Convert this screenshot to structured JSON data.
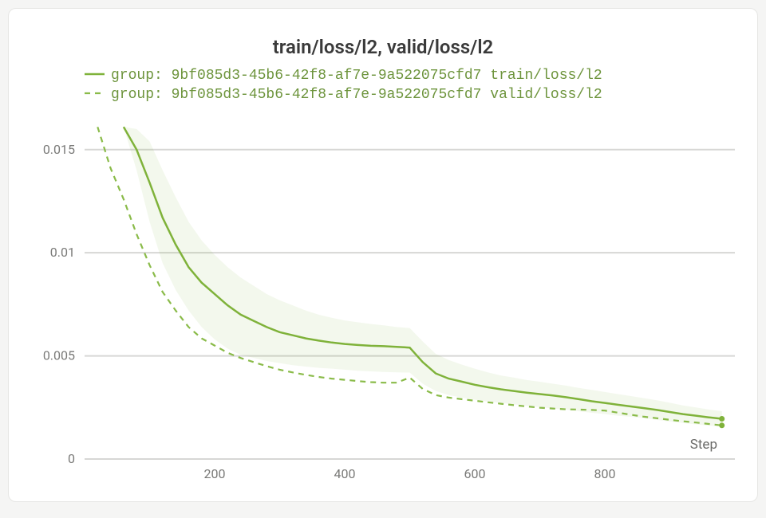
{
  "chart_data": {
    "type": "line",
    "title": "train/loss/l2, valid/loss/l2",
    "xlabel": "Step",
    "ylabel": "",
    "xlim": [
      0,
      1000
    ],
    "ylim": [
      0,
      0.017
    ],
    "x_ticks": [
      200,
      400,
      600,
      800
    ],
    "y_ticks": [
      0,
      0.005,
      0.01,
      0.015
    ],
    "legend_position": "top",
    "series": [
      {
        "name": "group: 9bf085d3-45b6-42f8-af7e-9a522075cfd7 train/loss/l2",
        "style": "solid",
        "x": [
          60,
          80,
          100,
          120,
          140,
          160,
          180,
          200,
          220,
          240,
          260,
          280,
          300,
          320,
          340,
          360,
          380,
          400,
          420,
          440,
          460,
          480,
          500,
          520,
          540,
          560,
          580,
          600,
          620,
          640,
          660,
          680,
          700,
          720,
          740,
          760,
          780,
          800,
          820,
          840,
          860,
          880,
          900,
          920,
          940,
          960,
          980
        ],
        "values": [
          0.0161,
          0.015,
          0.0134,
          0.0117,
          0.0104,
          0.0093,
          0.00855,
          0.008,
          0.00745,
          0.007,
          0.0067,
          0.0064,
          0.00615,
          0.006,
          0.00585,
          0.00574,
          0.00565,
          0.00558,
          0.00553,
          0.00549,
          0.00547,
          0.00544,
          0.0054,
          0.0047,
          0.00415,
          0.0039,
          0.00375,
          0.0036,
          0.00348,
          0.00338,
          0.0033,
          0.00322,
          0.00315,
          0.00308,
          0.003,
          0.0029,
          0.0028,
          0.00272,
          0.00263,
          0.00255,
          0.00247,
          0.00238,
          0.00228,
          0.00218,
          0.0021,
          0.00202,
          0.00195
        ],
        "band_lo": [
          0.0161,
          0.014,
          0.0115,
          0.0095,
          0.0082,
          0.0072,
          0.0064,
          0.0058,
          0.00535,
          0.00505,
          0.0049,
          0.00475,
          0.00465,
          0.00455,
          0.00448,
          0.00442,
          0.00438,
          0.00433,
          0.00428,
          0.00425,
          0.00422,
          0.0042,
          0.00419,
          0.00365,
          0.0033,
          0.0031,
          0.00298,
          0.00288,
          0.00278,
          0.00272,
          0.00265,
          0.00258,
          0.00252,
          0.00245,
          0.0024,
          0.00232,
          0.00224,
          0.00218,
          0.0021,
          0.00205,
          0.00198,
          0.0019,
          0.00182,
          0.00175,
          0.00168,
          0.00162,
          0.00156
        ],
        "band_hi": [
          0.0161,
          0.016,
          0.0154,
          0.014,
          0.0127,
          0.0115,
          0.0106,
          0.0099,
          0.0093,
          0.0088,
          0.0084,
          0.008,
          0.0077,
          0.00745,
          0.0072,
          0.007,
          0.00685,
          0.00672,
          0.00663,
          0.00655,
          0.00648,
          0.0064,
          0.00635,
          0.0057,
          0.0051,
          0.0048,
          0.00458,
          0.00438,
          0.0042,
          0.00405,
          0.00395,
          0.00383,
          0.00375,
          0.00365,
          0.00356,
          0.00345,
          0.00335,
          0.00325,
          0.00315,
          0.00305,
          0.00295,
          0.00285,
          0.00273,
          0.0026,
          0.0025,
          0.0024,
          0.00232
        ]
      },
      {
        "name": "group: 9bf085d3-45b6-42f8-af7e-9a522075cfd7 valid/loss/l2",
        "style": "dashed",
        "x": [
          20,
          40,
          60,
          80,
          100,
          120,
          140,
          160,
          180,
          200,
          220,
          240,
          260,
          280,
          300,
          320,
          340,
          360,
          380,
          400,
          420,
          440,
          460,
          480,
          500,
          520,
          540,
          560,
          580,
          600,
          620,
          640,
          660,
          680,
          700,
          720,
          740,
          760,
          780,
          800,
          820,
          840,
          860,
          880,
          900,
          920,
          940,
          960,
          980
        ],
        "values": [
          0.0161,
          0.0141,
          0.0126,
          0.0109,
          0.0094,
          0.0081,
          0.0072,
          0.0064,
          0.00585,
          0.0055,
          0.00515,
          0.0049,
          0.0047,
          0.0045,
          0.00433,
          0.0042,
          0.00408,
          0.00398,
          0.0039,
          0.00384,
          0.00378,
          0.00373,
          0.0037,
          0.0037,
          0.00395,
          0.0034,
          0.0031,
          0.00298,
          0.0029,
          0.00283,
          0.00275,
          0.00268,
          0.00261,
          0.00255,
          0.00249,
          0.00245,
          0.00241,
          0.0024,
          0.00238,
          0.00235,
          0.00225,
          0.00215,
          0.00205,
          0.00198,
          0.0019,
          0.00183,
          0.00177,
          0.0017,
          0.00163
        ]
      }
    ]
  },
  "x_tick_labels": {
    "200": "200",
    "400": "400",
    "600": "600",
    "800": "800"
  },
  "y_tick_labels": {
    "0": "0",
    "0.005": "0.005",
    "0.01": "0.01",
    "0.015": "0.015"
  }
}
